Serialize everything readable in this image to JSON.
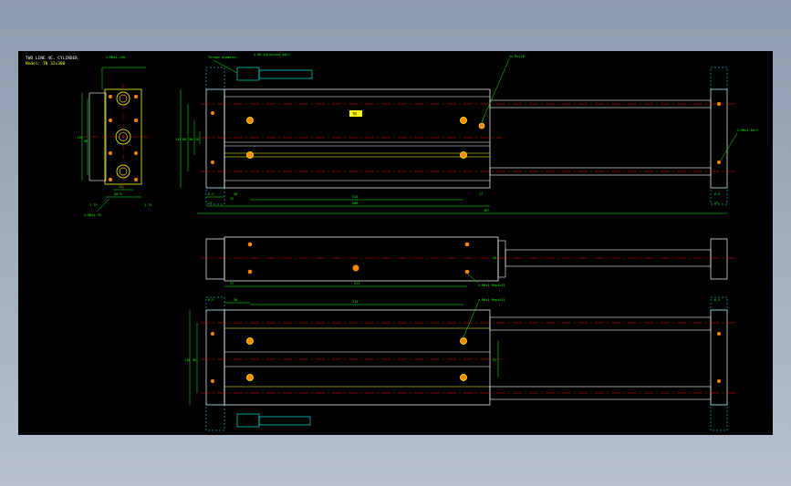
{
  "title_block": {
    "line1": "TWO LINE 4E. CYLINDER",
    "line2": "Model: TN 32x300"
  },
  "colors": {
    "background": "#000000",
    "outline": "#ffffff",
    "dimension": "#00ff00",
    "hidden": "#00ffff",
    "center": "#ff0000",
    "part": "#ffff00",
    "port": "#ff8800"
  },
  "side_view": {
    "note_top": "2-M8x1.25p",
    "dims": {
      "width_top": "24",
      "height_total": "110",
      "height_inner": "98",
      "bottom_1": "50.5",
      "bottom_2": "24",
      "edge_left": "1.75",
      "edge_right": "1.75",
      "note_bottom": "4-M8x1.25"
    }
  },
  "top_view": {
    "notes": {
      "left_1": "Thread diameter",
      "left_2": "2-M5 Adjusting bolt",
      "right_1": "2x Rc1/8\"",
      "right_2": "2-M6x1 Bolt"
    },
    "dims": {
      "d1": "6.5",
      "d2": "27",
      "d3": "20",
      "d4": "12",
      "stroke_inner": "313",
      "stroke": "300",
      "d5": "17",
      "d6": "6.5",
      "d7": "27",
      "total": "387",
      "h1": "147",
      "h2": "80",
      "h3": "50",
      "h4": "28"
    },
    "label_plate": "TN"
  },
  "middle_view": {
    "dims": {
      "d1": "27",
      "d2": "313",
      "d3": "28"
    },
    "note": "4-M6x1 Depth12"
  },
  "bottom_view": {
    "dims": {
      "left": "6.5",
      "d1": "30",
      "span": "313",
      "right": "6.5",
      "h_total": "110",
      "h_inner": "98",
      "h_right": "32"
    },
    "note": "4-M6x1 Depth12"
  }
}
